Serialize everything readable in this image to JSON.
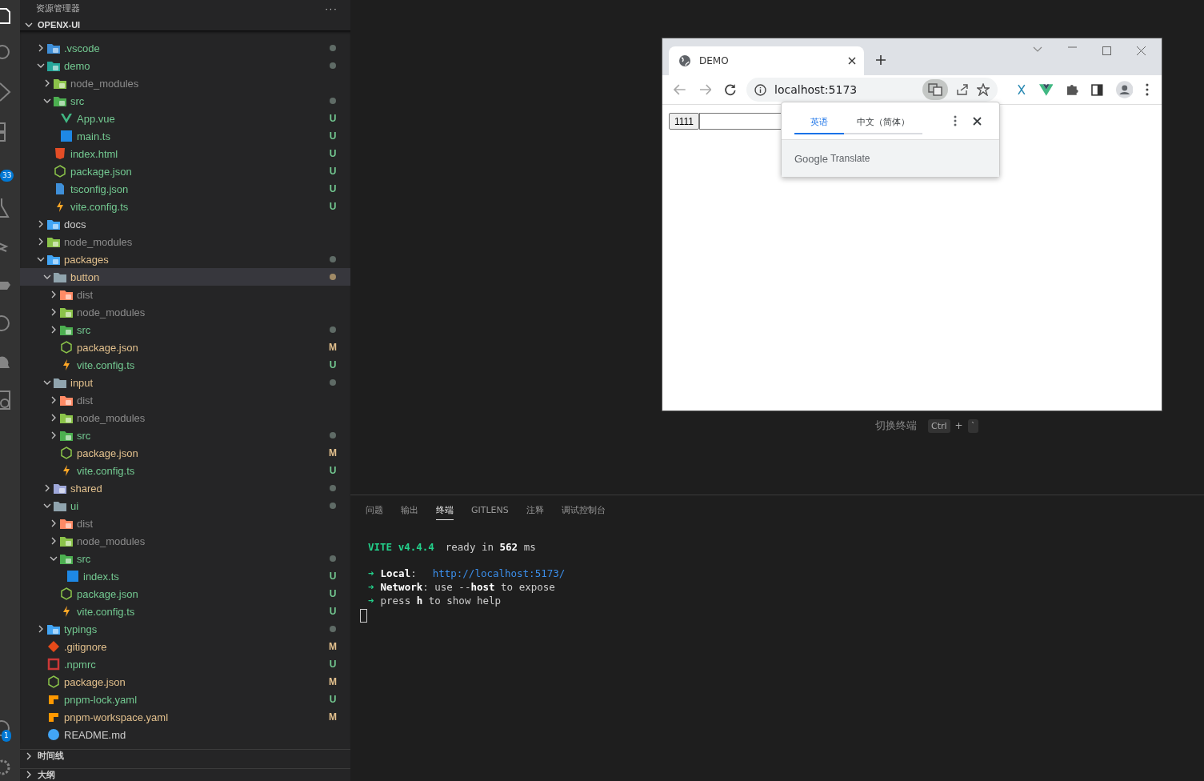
{
  "activity_bar": {
    "badges": [
      {
        "text": "33"
      },
      {
        "text": "1"
      }
    ]
  },
  "sidebar": {
    "title": "资源管理器",
    "more": "···",
    "root": {
      "label": "OPENX-UI",
      "expanded": true
    },
    "tree": [
      {
        "name": ".vscode",
        "kind": "vscode",
        "expanded": false,
        "color": "#73c991",
        "changed": true,
        "selected": false
      },
      {
        "name": "demo",
        "kind": "demo",
        "expanded": true,
        "color": "#73c991",
        "changed": true,
        "selected": false,
        "children": [
          {
            "name": "node_modules",
            "kind": "node",
            "expanded": false,
            "color": "#8c8c8c",
            "changed": false,
            "selected": false
          },
          {
            "name": "src",
            "kind": "src",
            "expanded": true,
            "color": "#73c991",
            "changed": true,
            "selected": false,
            "children": [
              {
                "name": "App.vue",
                "kind": "vue",
                "color": "#73c991",
                "badge": "U",
                "selected": false
              },
              {
                "name": "main.ts",
                "kind": "ts",
                "color": "#73c991",
                "badge": "U",
                "selected": false
              }
            ]
          },
          {
            "name": "index.html",
            "kind": "html",
            "color": "#73c991",
            "badge": "U",
            "selected": false
          },
          {
            "name": "package.json",
            "kind": "json",
            "color": "#73c991",
            "badge": "U",
            "selected": false
          },
          {
            "name": "tsconfig.json",
            "kind": "tsconfig",
            "color": "#73c991",
            "badge": "U",
            "selected": false
          },
          {
            "name": "vite.config.ts",
            "kind": "vite",
            "color": "#73c991",
            "badge": "U",
            "selected": false
          }
        ]
      },
      {
        "name": "docs",
        "kind": "docs",
        "expanded": false,
        "color": "#cccccc",
        "changed": false,
        "selected": false
      },
      {
        "name": "node_modules",
        "kind": "node",
        "expanded": false,
        "color": "#8c8c8c",
        "changed": false,
        "selected": false
      },
      {
        "name": "packages",
        "kind": "packages",
        "expanded": true,
        "color": "#e2c08d",
        "changed": true,
        "selected": false,
        "children": [
          {
            "name": "button",
            "kind": "folder",
            "expanded": true,
            "color": "#e2c08d",
            "changed": true,
            "selected": true,
            "children": [
              {
                "name": "dist",
                "kind": "dist",
                "expanded": false,
                "color": "#8c8c8c",
                "changed": false,
                "selected": false
              },
              {
                "name": "node_modules",
                "kind": "node",
                "expanded": false,
                "color": "#8c8c8c",
                "changed": false,
                "selected": false
              },
              {
                "name": "src",
                "kind": "src",
                "expanded": false,
                "color": "#73c991",
                "changed": true,
                "selected": false
              },
              {
                "name": "package.json",
                "kind": "json",
                "color": "#e2c08d",
                "badge": "M",
                "selected": false
              },
              {
                "name": "vite.config.ts",
                "kind": "vite",
                "color": "#73c991",
                "badge": "U",
                "selected": false
              }
            ]
          },
          {
            "name": "input",
            "kind": "folder",
            "expanded": true,
            "color": "#e2c08d",
            "changed": true,
            "selected": false,
            "children": [
              {
                "name": "dist",
                "kind": "dist",
                "expanded": false,
                "color": "#8c8c8c",
                "changed": false,
                "selected": false
              },
              {
                "name": "node_modules",
                "kind": "node",
                "expanded": false,
                "color": "#8c8c8c",
                "changed": false,
                "selected": false
              },
              {
                "name": "src",
                "kind": "src",
                "expanded": false,
                "color": "#73c991",
                "changed": true,
                "selected": false
              },
              {
                "name": "package.json",
                "kind": "json",
                "color": "#e2c08d",
                "badge": "M",
                "selected": false
              },
              {
                "name": "vite.config.ts",
                "kind": "vite",
                "color": "#73c991",
                "badge": "U",
                "selected": false
              }
            ]
          },
          {
            "name": "shared",
            "kind": "shared",
            "expanded": false,
            "color": "#e2c08d",
            "changed": true,
            "selected": false
          },
          {
            "name": "ui",
            "kind": "folder",
            "expanded": true,
            "color": "#73c991",
            "changed": true,
            "selected": false,
            "children": [
              {
                "name": "dist",
                "kind": "dist",
                "expanded": false,
                "color": "#8c8c8c",
                "changed": false,
                "selected": false
              },
              {
                "name": "node_modules",
                "kind": "node",
                "expanded": false,
                "color": "#8c8c8c",
                "changed": false,
                "selected": false
              },
              {
                "name": "src",
                "kind": "src",
                "expanded": true,
                "color": "#73c991",
                "changed": true,
                "selected": false,
                "children": [
                  {
                    "name": "index.ts",
                    "kind": "ts",
                    "color": "#73c991",
                    "badge": "U",
                    "selected": false
                  }
                ]
              },
              {
                "name": "package.json",
                "kind": "json",
                "color": "#73c991",
                "badge": "U",
                "selected": false
              },
              {
                "name": "vite.config.ts",
                "kind": "vite",
                "color": "#73c991",
                "badge": "U",
                "selected": false
              }
            ]
          }
        ]
      },
      {
        "name": "typings",
        "kind": "typings",
        "expanded": false,
        "color": "#73c991",
        "changed": true,
        "selected": false
      },
      {
        "name": ".gitignore",
        "kind": "git",
        "color": "#e2c08d",
        "badge": "M",
        "selected": false
      },
      {
        "name": ".npmrc",
        "kind": "npm",
        "color": "#73c991",
        "badge": "U",
        "selected": false
      },
      {
        "name": "package.json",
        "kind": "json",
        "color": "#e2c08d",
        "badge": "M",
        "selected": false
      },
      {
        "name": "pnpm-lock.yaml",
        "kind": "yaml",
        "color": "#73c991",
        "badge": "U",
        "selected": false
      },
      {
        "name": "pnpm-workspace.yaml",
        "kind": "yaml",
        "color": "#e2c08d",
        "badge": "M",
        "selected": false
      },
      {
        "name": "README.md",
        "kind": "info",
        "color": "#cccccc",
        "selected": false
      }
    ],
    "sections": [
      {
        "label": "时间线",
        "expanded": false
      },
      {
        "label": "大纲",
        "expanded": false
      }
    ]
  },
  "browser": {
    "tab_title": "DEMO",
    "address": "localhost:5173",
    "page": {
      "button": "1111"
    },
    "translate_popup": {
      "tabs": [
        {
          "label": "英语",
          "selected": true
        },
        {
          "label": "中文（简体）",
          "selected": false
        }
      ],
      "footer_brand": "Google",
      "footer_product": "Translate"
    }
  },
  "terminal_hint": {
    "label": "切换终端",
    "keys": [
      "Ctrl",
      "`"
    ],
    "joiner": "+"
  },
  "panel": {
    "tabs": [
      {
        "label": "问题",
        "selected": false
      },
      {
        "label": "输出",
        "selected": false
      },
      {
        "label": "终端",
        "selected": true
      },
      {
        "label": "GITLENS",
        "selected": false
      },
      {
        "label": "注释",
        "selected": false
      },
      {
        "label": "调试控制台",
        "selected": false
      }
    ],
    "terminal": {
      "banner": {
        "tag": "VITE v4.4.4",
        "text": "ready in **562** ms"
      },
      "lines": [
        {
          "arrow": "➜",
          "text": "**Local**:",
          "link": "http://localhost:5173/"
        },
        {
          "arrow": "➜",
          "text": "**Network**: use --**host** to expose"
        },
        {
          "arrow": "➜",
          "text": "press **h** to show help"
        }
      ]
    }
  }
}
